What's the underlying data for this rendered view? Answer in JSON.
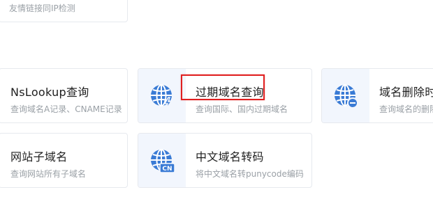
{
  "cards": {
    "ip_check": {
      "desc": "友情链接同IP检测"
    },
    "nslookup": {
      "title": "NsLookup查询",
      "desc": "查询域名A记录、CNAME记录"
    },
    "expired": {
      "title": "过期域名查询",
      "desc": "查询国际、国内过期域名"
    },
    "delete_time": {
      "title": "域名删除时间",
      "desc": "查询域名的删除时间"
    },
    "subdomain": {
      "title": "网站子域名",
      "desc": "查询网站所有子域名"
    },
    "cn_convert": {
      "title": "中文域名转码",
      "desc": "将中文域名转punycode编码",
      "badge": "CN"
    }
  },
  "icons": {
    "expired": "globe-bolt-icon",
    "delete_time": "globe-minus-icon",
    "cn_convert": "globe-cn-icon"
  },
  "colors": {
    "accent": "#3a7bd5",
    "highlight": "#e02020"
  }
}
